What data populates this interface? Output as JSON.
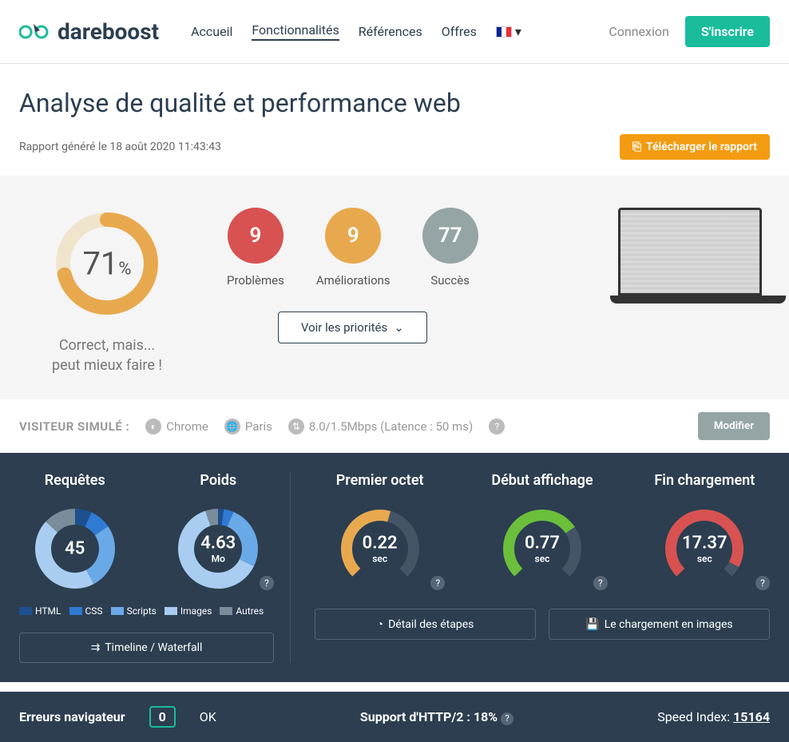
{
  "brand": "dareboost",
  "nav": {
    "home": "Accueil",
    "features": "Fonctionnalités",
    "references": "Références",
    "offers": "Offres",
    "login": "Connexion",
    "signup": "S'inscrire"
  },
  "page": {
    "title": "Analyse de qualité et performance web",
    "report_date": "Rapport généré le 18 août 2020 11:43:43",
    "download": "Télécharger le rapport"
  },
  "score": {
    "value": "71",
    "pct": "%",
    "label_line1": "Correct, mais...",
    "label_line2": "peut mieux faire !"
  },
  "counters": {
    "problems": {
      "value": "9",
      "label": "Problèmes"
    },
    "improvements": {
      "value": "9",
      "label": "Améliorations"
    },
    "success": {
      "value": "77",
      "label": "Succès"
    }
  },
  "priorities_btn": "Voir les priorités",
  "visitor": {
    "label": "VISITEUR SIMULÉ :",
    "browser": "Chrome",
    "location": "Paris",
    "bandwidth": "8.0/1.5Mbps (Latence : 50 ms)",
    "modify": "Modifier"
  },
  "metrics": {
    "requests": {
      "title": "Requêtes",
      "value": "45"
    },
    "weight": {
      "title": "Poids",
      "value": "4.63",
      "unit": "Mo"
    },
    "ttfb": {
      "title": "Premier octet",
      "value": "0.22",
      "unit": "sec"
    },
    "start_render": {
      "title": "Début affichage",
      "value": "0.77",
      "unit": "sec"
    },
    "load": {
      "title": "Fin chargement",
      "value": "17.37",
      "unit": "sec"
    }
  },
  "legend": {
    "html": "HTML",
    "css": "CSS",
    "scripts": "Scripts",
    "images": "Images",
    "other": "Autres"
  },
  "buttons": {
    "timeline": "Timeline / Waterfall",
    "steps": "Détail des étapes",
    "filmstrip": "Le chargement en images"
  },
  "bottom": {
    "errors_label": "Erreurs navigateur",
    "errors_count": "0",
    "errors_status": "OK",
    "http2_label": "Support d'HTTP/2 :",
    "http2_value": "18%",
    "speed_label": "Speed Index:",
    "speed_value": "15164"
  },
  "colors": {
    "orange": "#e8a94e",
    "green": "#6bbf3b",
    "red": "#d85252",
    "blue1": "#1e4f8f",
    "blue2": "#2f7bd4",
    "blue3": "#6aa9e8",
    "blue4": "#a8cdf0",
    "gray": "#7a8b9a"
  },
  "chart_data": [
    {
      "type": "pie",
      "title": "Requêtes",
      "categories": [
        "HTML",
        "CSS",
        "Scripts",
        "Images",
        "Autres"
      ],
      "values": [
        3,
        4,
        12,
        20,
        6
      ],
      "total": 45
    },
    {
      "type": "pie",
      "title": "Poids (Mo)",
      "categories": [
        "HTML",
        "CSS",
        "Scripts",
        "Images",
        "Autres"
      ],
      "values": [
        0.1,
        0.18,
        1.2,
        2.9,
        0.25
      ],
      "total": 4.63
    }
  ]
}
